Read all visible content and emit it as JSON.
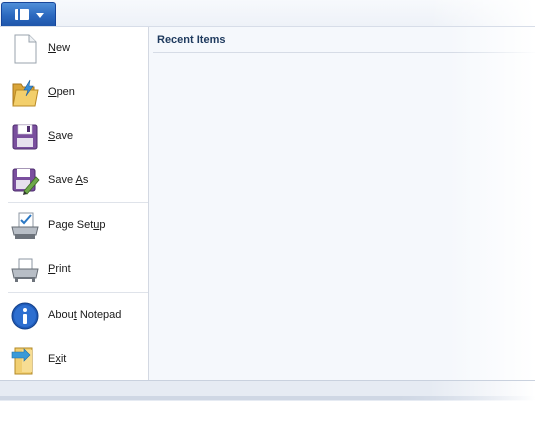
{
  "menu_button": {
    "icon": "notepad-menu-icon",
    "caret_icon": "chevron-down-icon"
  },
  "menu_items": [
    {
      "label": "New",
      "accesskey": "N",
      "icon": "new-document-icon"
    },
    {
      "label": "Open",
      "accesskey": "O",
      "icon": "open-folder-icon"
    },
    {
      "label": "Save",
      "accesskey": "S",
      "icon": "save-disk-icon"
    },
    {
      "label": "Save As",
      "accesskey": "A",
      "icon": "save-as-icon"
    },
    {
      "label": "Page Setup",
      "accesskey": "u",
      "icon": "page-setup-icon"
    },
    {
      "label": "Print",
      "accesskey": "P",
      "icon": "printer-icon"
    },
    {
      "label": "About Notepad",
      "accesskey": "t",
      "icon": "info-icon"
    },
    {
      "label": "Exit",
      "accesskey": "x",
      "icon": "exit-icon"
    }
  ],
  "recent": {
    "header": "Recent Items",
    "items": []
  },
  "colors": {
    "accent": "#2b68bf",
    "pane_bg": "#f5f8fc",
    "header_text": "#1e3a5e"
  }
}
